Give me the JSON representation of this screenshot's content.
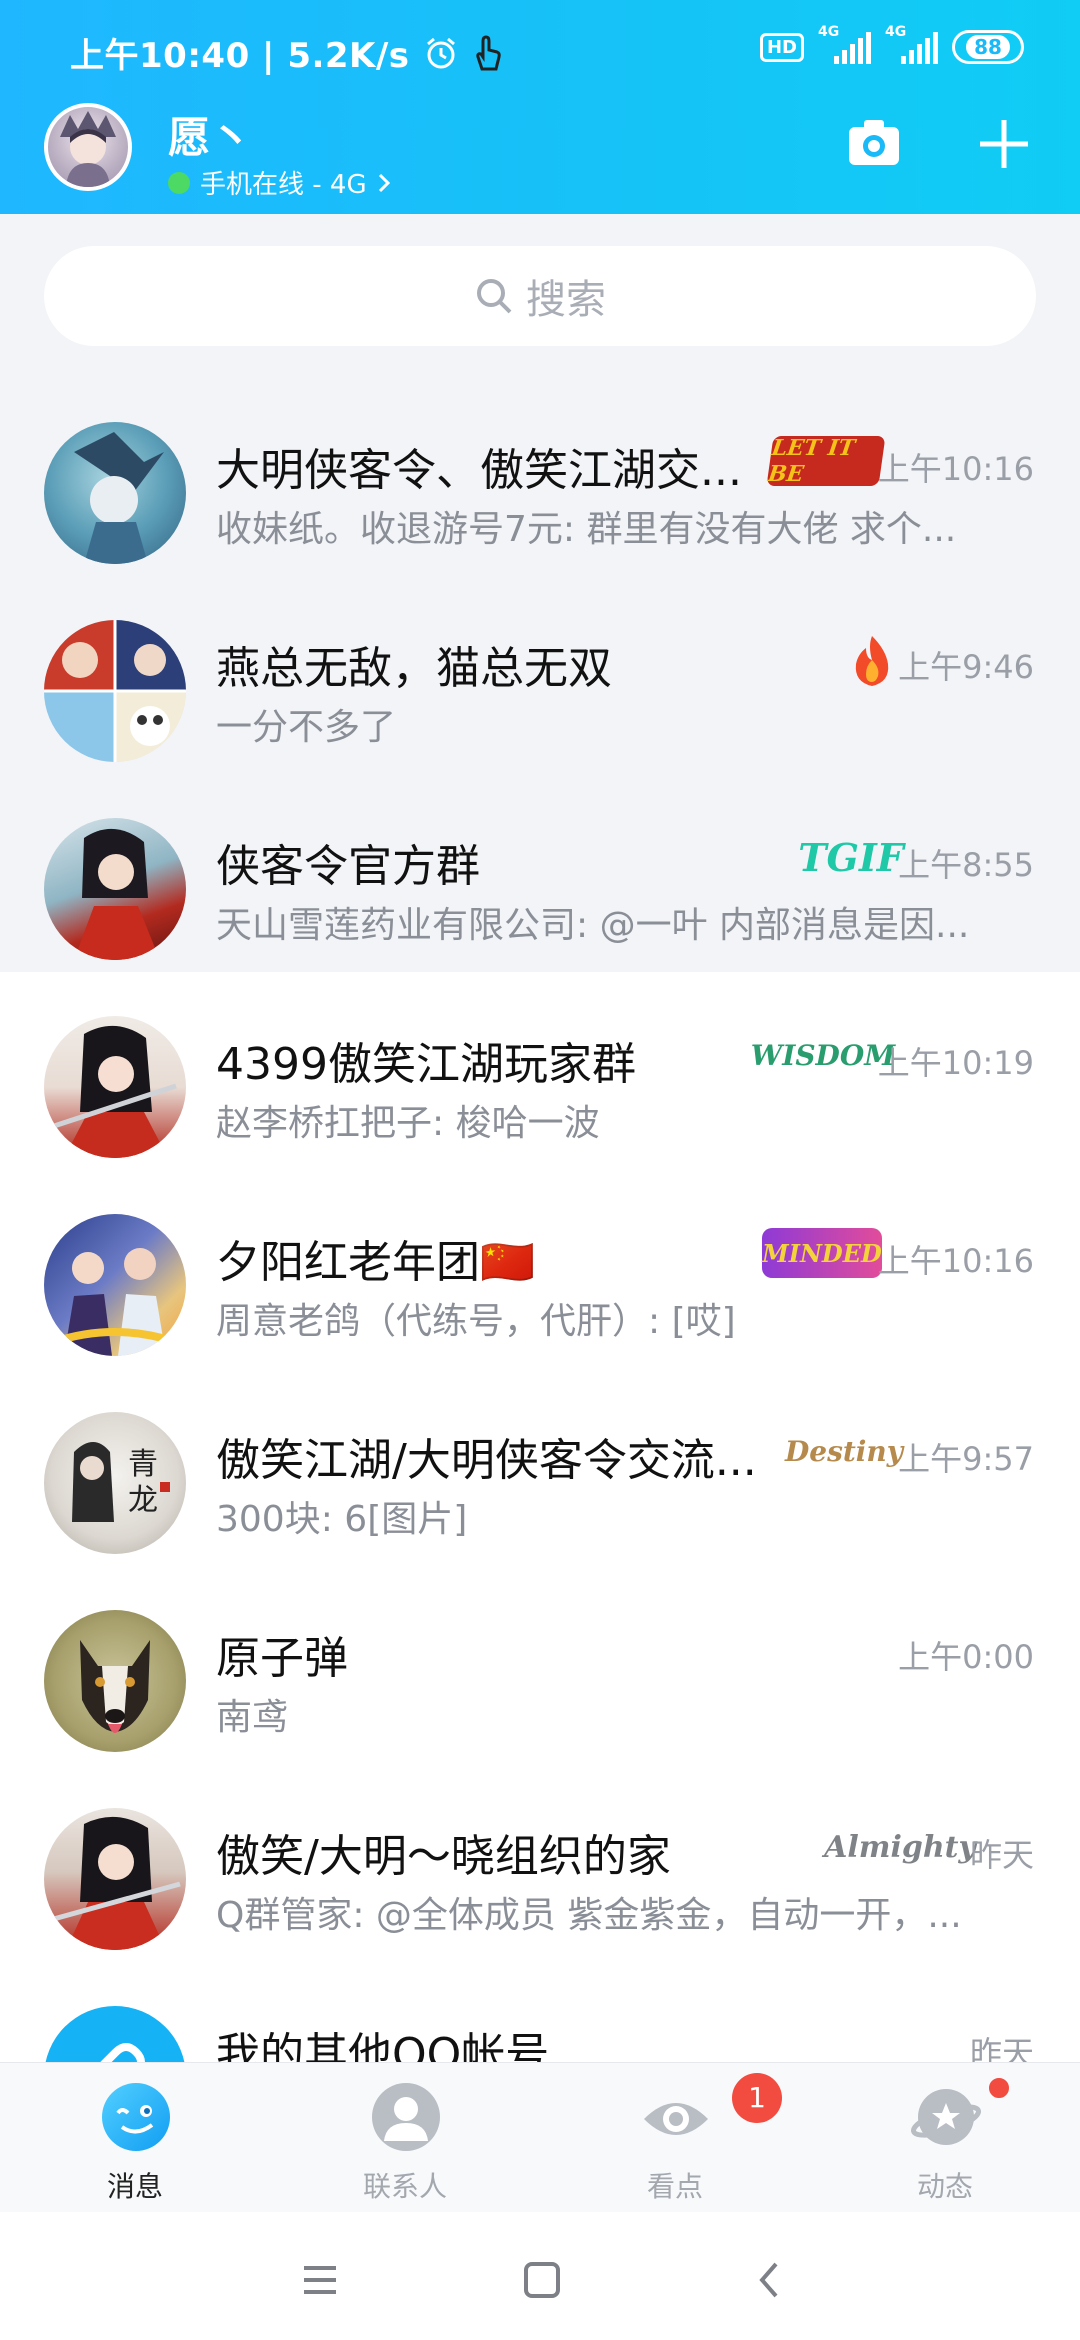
{
  "status_bar": {
    "time_speed": "上午10:40 | 5.2K/s",
    "hd": "HD",
    "net1": "4G",
    "net2": "4G",
    "battery": "88"
  },
  "header": {
    "user_name": "愿丶",
    "user_status": "手机在线 - 4G"
  },
  "search": {
    "placeholder": "搜索"
  },
  "chats": [
    {
      "name": "大明侠客令、傲笑江湖交...",
      "message": "收妹纸。收退游号7元: 群里有没有大佬  求个...",
      "time": "上午10:16",
      "badge": "LET IT BE",
      "pinned": true
    },
    {
      "name": "燕总无敌，猫总无双",
      "message": "一分不多了",
      "time": "上午9:46",
      "badge": "fire",
      "pinned": true
    },
    {
      "name": "侠客令官方群",
      "message": "天山雪莲药业有限公司: @一叶 内部消息是因...",
      "time": "上午8:55",
      "badge": "TGIF",
      "pinned": true
    },
    {
      "name": "4399傲笑江湖玩家群",
      "message": "赵李桥扛把子: 梭哈一波",
      "time": "上午10:19",
      "badge": "WISDOM",
      "pinned": false
    },
    {
      "name": "夕阳红老年团🇨🇳",
      "message": "周意老鸽（代练号，代肝）: [哎]",
      "time": "上午10:16",
      "badge": "MINDED",
      "pinned": false
    },
    {
      "name": "傲笑江湖/大明侠客令交流...",
      "message": "300块: 6[图片]",
      "time": "上午9:57",
      "badge": "Destiny",
      "pinned": false
    },
    {
      "name": "原子弹",
      "message": "南鸢",
      "time": "上午0:00",
      "badge": "",
      "pinned": false
    },
    {
      "name": "傲笑/大明～晓组织的家",
      "message": "Q群管家: @全体成员 紫金紫金，自动一开，...",
      "time": "昨天",
      "badge": "Almighty",
      "pinned": false
    },
    {
      "name": "我的其他QQ帐号",
      "message": "",
      "time": "昨天",
      "badge": "",
      "pinned": false
    }
  ],
  "nav": {
    "messages": "消息",
    "contacts": "联系人",
    "watch": "看点",
    "watch_badge": "1",
    "moments": "动态"
  },
  "colors": {
    "header_blue": "#1ab9f8",
    "badge_red": "#f24b3f",
    "online_green": "#4cd964"
  }
}
